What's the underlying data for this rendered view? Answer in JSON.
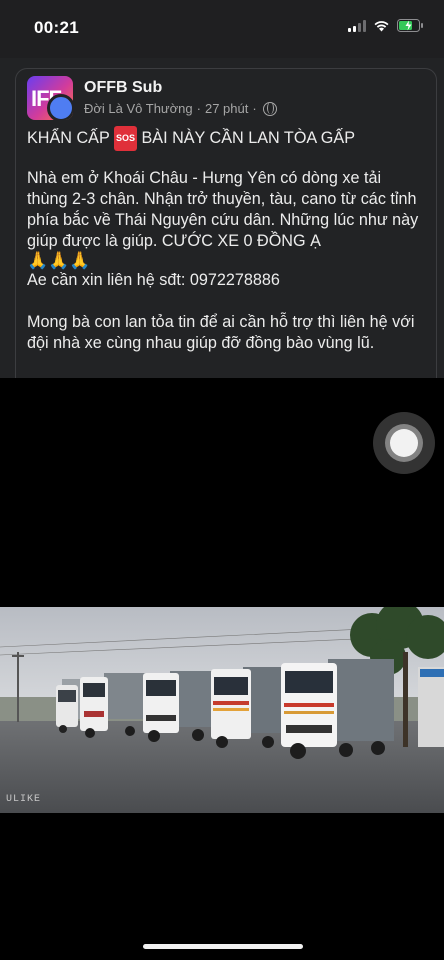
{
  "status_bar": {
    "time": "00:21"
  },
  "post": {
    "author": "OFFB Sub",
    "avatar_text": "IFF",
    "group": "Đời Là Vô Thường",
    "separator": "·",
    "time_ago": "27 phút",
    "separator2": "·",
    "line1_before": "KHẨN CẤP",
    "sos_label": "SOS",
    "line1_after": "BÀI NÀY CẦN LAN TÒA GẤP",
    "para1": "Nhà em ở Khoái Châu - Hưng Yên có dòng xe tải thùng 2-3 chân. Nhận trở thuyền, tàu, cano từ các tỉnh phía bắc về Thái Nguyên cứu dân. Những lúc như này giúp được là giúp. CƯỚC XE 0 ĐỒNG Ạ",
    "pray_emoji": "🙏🙏🙏",
    "contact": "Ae cần xin liên hệ sđt: 0972278886",
    "para2": "Mong bà con lan tỏa tin để ai cần hỗ trợ thì liên hệ với đội nhà xe cùng nhau giúp đỡ đồng bào vùng lũ."
  },
  "photo": {
    "watermark": "ULIKE"
  },
  "icons": {
    "signal": "signal-icon",
    "wifi": "wifi-icon",
    "battery": "battery-charging-icon",
    "globe": "globe-icon",
    "assistive_touch": "assistive-touch-icon"
  },
  "colors": {
    "post_bg": "#222325",
    "sos_red": "#e0303a",
    "battery_green": "#34c759"
  }
}
